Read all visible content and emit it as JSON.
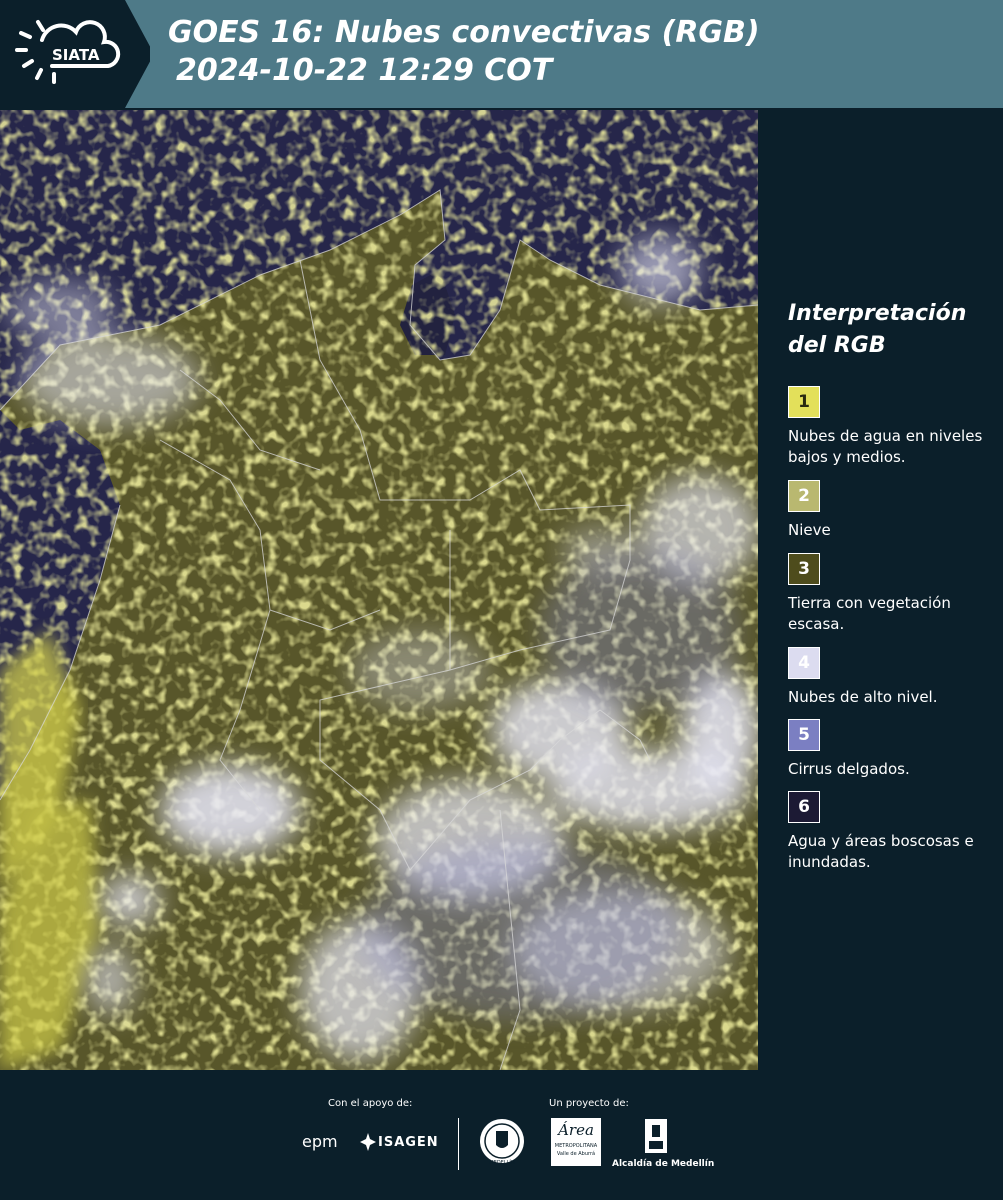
{
  "header": {
    "logo_text": "SIATA",
    "title_line1": "GOES 16: Nubes convectivas (RGB)",
    "title_line2": "2024-10-22 12:29 COT"
  },
  "legend": {
    "title_line1": "Interpretación",
    "title_line2": "del RGB",
    "items": [
      {
        "number": "1",
        "color": "#e3e05a",
        "text_color": "#2a2a10",
        "label": "Nubes de agua en niveles bajos y medios."
      },
      {
        "number": "2",
        "color": "#b9b870",
        "text_color": "#ffffff",
        "label": "Nieve"
      },
      {
        "number": "3",
        "color": "#4e4c1c",
        "text_color": "#ffffff",
        "label": "Tierra con vegetación escasa."
      },
      {
        "number": "4",
        "color": "#dcdcf0",
        "text_color": "#ffffff",
        "label": "Nubes de alto nivel."
      },
      {
        "number": "5",
        "color": "#7b7fc2",
        "text_color": "#ffffff",
        "label": "Cirrus delgados."
      },
      {
        "number": "6",
        "color": "#1c1a34",
        "text_color": "#ffffff",
        "label": "Agua y áreas boscosas e inundadas."
      }
    ]
  },
  "footer": {
    "support_label": "Con el apoyo de:",
    "project_label": "Un proyecto de:",
    "sponsors": [
      "epm",
      "ISAGEN"
    ],
    "partners": {
      "metro_main": "Área",
      "metro_line1": "METROPOLITANA",
      "metro_line2": "Valle de Aburrá",
      "medellin": "Alcaldía de Medellín",
      "seal_text": "MEDELLÍN"
    }
  },
  "colors": {
    "header_bg": "#4e7a88",
    "page_bg": "#0b1f2a",
    "ocean": "#26264a",
    "land": "#5c5a2a",
    "low_cloud": "#e3e05a",
    "high_cloud": "#e6e6f7"
  }
}
